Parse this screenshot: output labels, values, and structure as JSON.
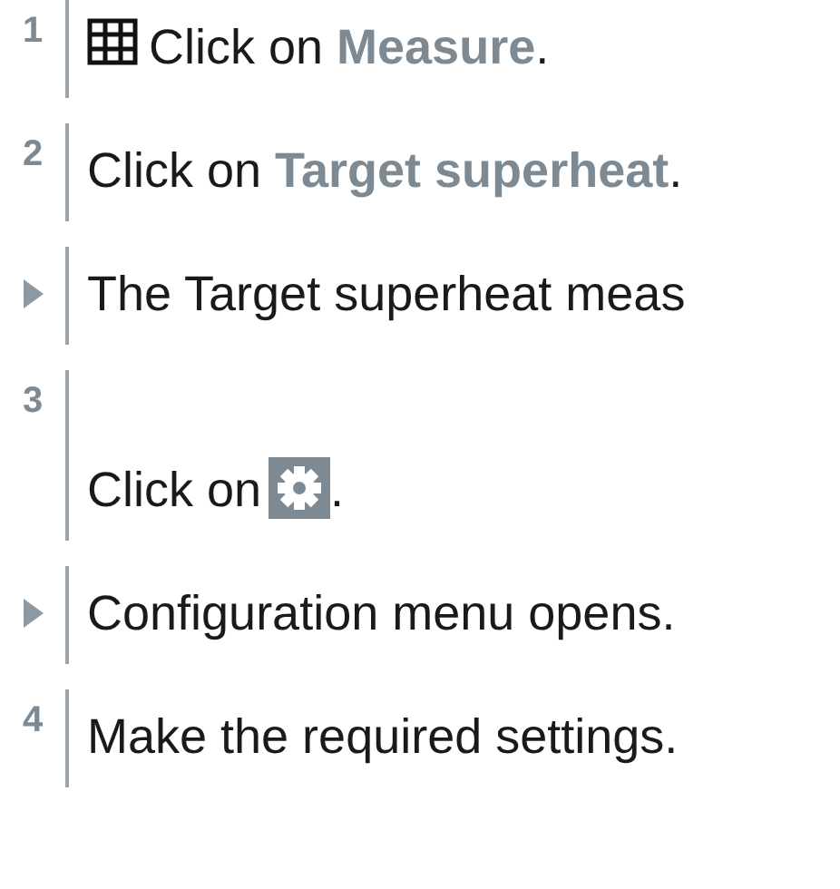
{
  "steps": [
    {
      "kind": "step",
      "number": "1",
      "parts": [
        {
          "kind": "grid-icon"
        },
        {
          "kind": "text",
          "text": "Click on **Measure**."
        }
      ]
    },
    {
      "kind": "step",
      "number": "2",
      "parts": [
        {
          "kind": "text",
          "text": "Click on **Target superheat**."
        }
      ]
    },
    {
      "kind": "result",
      "parts": [
        {
          "kind": "text",
          "text": "The Target superheat meas"
        }
      ]
    },
    {
      "kind": "step",
      "number": "3",
      "parts": [
        {
          "kind": "text",
          "text": "Click on"
        },
        {
          "kind": "gear-icon"
        },
        {
          "kind": "text",
          "text": "."
        }
      ]
    },
    {
      "kind": "result",
      "parts": [
        {
          "kind": "text",
          "text": "Configuration menu opens."
        }
      ]
    },
    {
      "kind": "step",
      "number": "4",
      "parts": [
        {
          "kind": "text",
          "text": "Make the required settings."
        }
      ]
    }
  ]
}
